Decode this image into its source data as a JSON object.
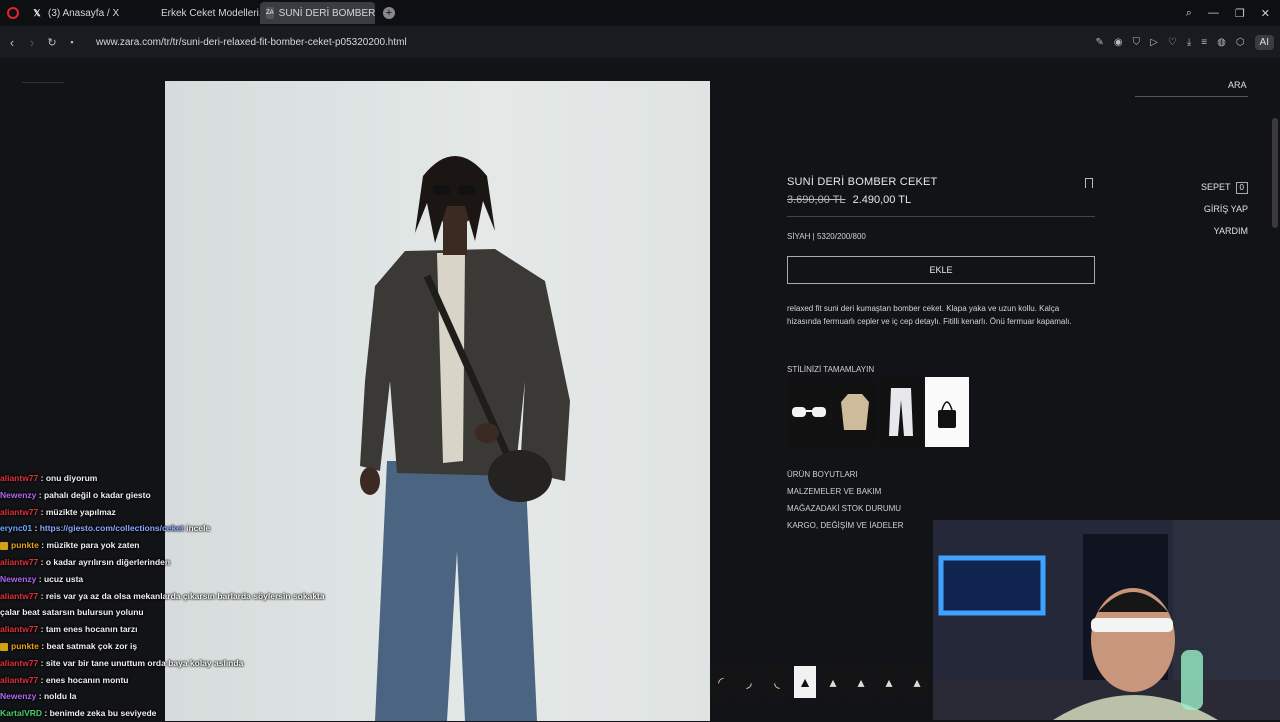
{
  "browser": {
    "tabs": [
      {
        "label": "(3) Anasayfa / X",
        "icon": "x-icon"
      },
      {
        "label": "Erkek Ceket Modelleri, Erk",
        "icon": "globe-icon"
      },
      {
        "label": "SUNİ DERİ BOMBER CEKE",
        "icon": "zara-icon",
        "active": true
      }
    ],
    "url": "www.zara.com/tr/tr/suni-deri-relaxed-fit-bomber-ceket-p05320200.html",
    "ai_label": "AI"
  },
  "site": {
    "search_label": "ARA",
    "side_links": {
      "cart": "SEPET",
      "cart_count": "0",
      "login": "GİRİŞ YAP",
      "help": "YARDIM"
    }
  },
  "product": {
    "title": "SUNİ DERİ BOMBER CEKET",
    "old_price": "3.690,00 TL",
    "price": "2.490,00 TL",
    "color_code": "SİYAH | 5320/200/800",
    "add_button": "EKLE",
    "description": "relaxed fit suni deri kumaştan bomber ceket. Klapa yaka ve uzun kollu. Kalça hizasında fermuarlı cepler ve iç cep detaylı. Fitilli kenarlı. Önü fermuar kapamalı.",
    "complete_label": "STİLİNİZİ TAMAMLAYIN",
    "accordions": [
      "ÜRÜN BOYUTLARI",
      "MALZEMELER VE BAKIM",
      "MAĞAZADAKİ STOK DURUMU",
      "KARGO, DEĞİŞİM VE İADELER"
    ]
  },
  "chat": [
    {
      "user": "aliantw77",
      "color": "#e0303a",
      "text": "onu diyorum"
    },
    {
      "user": "Newenzy",
      "color": "#b067f2",
      "text": "pahalı değil o kadar giesto"
    },
    {
      "user": "aliantw77",
      "color": "#e0303a",
      "text": "müzikte yapılmaz"
    },
    {
      "user": "erync01",
      "color": "#6fa8ff",
      "text": "https://giesto.com/collections/ceket",
      "suffix": " incele",
      "link": true
    },
    {
      "user": "punkte",
      "color": "#e7a21a",
      "text": "müzikte para yok zaten",
      "badge": true
    },
    {
      "user": "aliantw77",
      "color": "#e0303a",
      "text": "o kadar ayrılırsın diğerlerinden"
    },
    {
      "user": "Newenzy",
      "color": "#b067f2",
      "text": "ucuz usta"
    },
    {
      "user": "aliantw77",
      "color": "#e0303a",
      "text": "reis var ya az da olsa mekanlarda çıkarsın barlarda söylersin sokakta"
    },
    {
      "user": "",
      "color": "#f0f0f0",
      "text": "çalar beat satarsın bulursun yolunu"
    },
    {
      "user": "aliantw77",
      "color": "#e0303a",
      "text": "tam enes hocanın tarzı"
    },
    {
      "user": "punkte",
      "color": "#e7a21a",
      "text": "beat satmak çok zor iş",
      "badge": true
    },
    {
      "user": "aliantw77",
      "color": "#e0303a",
      "text": "site var bir tane unuttum orda baya kolay aslında"
    },
    {
      "user": "aliantw77",
      "color": "#e0303a",
      "text": "enes hocanın montu"
    },
    {
      "user": "Newenzy",
      "color": "#b067f2",
      "text": "noldu la"
    },
    {
      "user": "KartalVRD",
      "color": "#4ccf6a",
      "text": "benimde zeka bu seviyede"
    }
  ]
}
